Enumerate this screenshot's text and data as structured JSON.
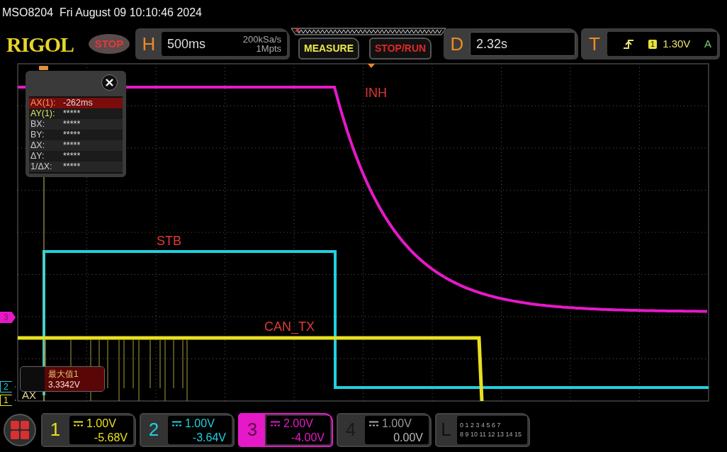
{
  "title": "MSO8204  Fri August 09 10:10:46 2024",
  "logo": "RIGOL",
  "run_state": {
    "label": "STOP"
  },
  "horizontal": {
    "letter": "H",
    "timebase": "500ms",
    "sample_rate": "200kSa/s",
    "memory_depth": "1Mpts"
  },
  "buttons": [
    {
      "label": "MEASURE",
      "kind": "measure"
    },
    {
      "label": "STOP/RUN",
      "kind": "run"
    }
  ],
  "delay": {
    "letter": "D",
    "value": "2.32s"
  },
  "trigger": {
    "letter": "T",
    "source": "1",
    "level": "1.30V",
    "mode": "A"
  },
  "cursor_table": {
    "rows": [
      {
        "label": "AX(1):",
        "value": "-262ms",
        "selected": true,
        "kind": "a"
      },
      {
        "label": "AY(1):",
        "value": "*****",
        "selected": false,
        "kind": "a"
      },
      {
        "label": "BX:",
        "value": "*****",
        "selected": false,
        "kind": "b"
      },
      {
        "label": "BY:",
        "value": "*****",
        "selected": false,
        "kind": "b"
      },
      {
        "label": "ΔX:",
        "value": "*****",
        "selected": false,
        "kind": "delta"
      },
      {
        "label": "ΔY:",
        "value": "*****",
        "selected": false,
        "kind": "delta"
      },
      {
        "label": "1/ΔX:",
        "value": "*****",
        "selected": false,
        "kind": "delta"
      }
    ]
  },
  "trace_labels": [
    "INH",
    "STB",
    "CAN_TX"
  ],
  "channel_markers": [
    {
      "label": "3",
      "color": "#e619c8"
    },
    {
      "label": "2",
      "color": "#20d0e0"
    },
    {
      "label": "1",
      "color": "#e8e020"
    }
  ],
  "measurement_popup": {
    "title": "最大值1",
    "value": "3.3342V"
  },
  "cursor_label": "AX",
  "channels": [
    {
      "number": "1",
      "scale": "1.00V",
      "offset": "-5.68V",
      "color": "#e8e020",
      "selected": false,
      "enabled": true
    },
    {
      "number": "2",
      "scale": "1.00V",
      "offset": "-3.64V",
      "color": "#20d0e0",
      "selected": false,
      "enabled": true
    },
    {
      "number": "3",
      "scale": "2.00V",
      "offset": "-4.00V",
      "color": "#e619c8",
      "selected": true,
      "enabled": true
    },
    {
      "number": "4",
      "scale": "1.00V",
      "offset": "0.00V",
      "color": "#9a9a9a",
      "selected": false,
      "enabled": false
    }
  ],
  "logic": {
    "letter": "L",
    "rows": [
      "0 1 2 3 4 5 6 7",
      "8 9 10 11 12 13 14 15"
    ]
  }
}
